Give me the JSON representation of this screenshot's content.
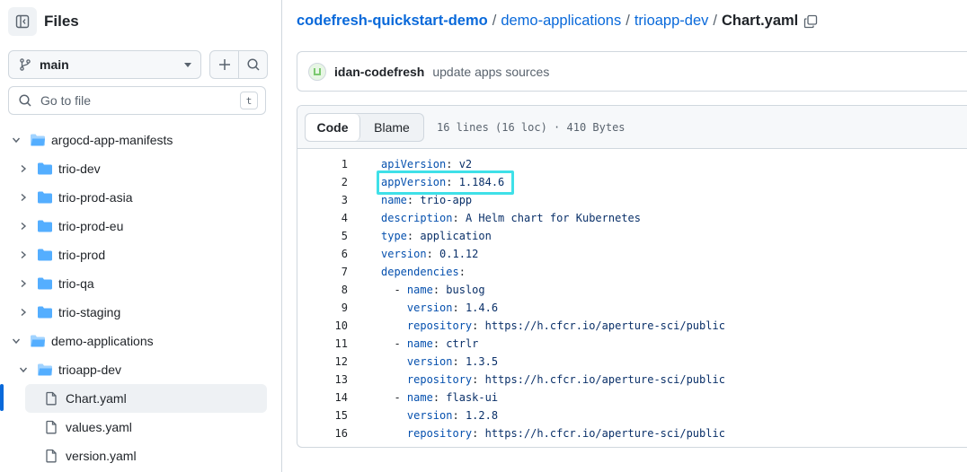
{
  "sidebar": {
    "title": "Files",
    "branch": "main",
    "goto_placeholder": "Go to file",
    "goto_shortcut": "t",
    "tree": [
      {
        "label": "argocd-app-manifests",
        "type": "folder",
        "open": true,
        "depth": 0
      },
      {
        "label": "trio-dev",
        "type": "folder",
        "open": false,
        "depth": 1
      },
      {
        "label": "trio-prod-asia",
        "type": "folder",
        "open": false,
        "depth": 1
      },
      {
        "label": "trio-prod-eu",
        "type": "folder",
        "open": false,
        "depth": 1
      },
      {
        "label": "trio-prod",
        "type": "folder",
        "open": false,
        "depth": 1
      },
      {
        "label": "trio-qa",
        "type": "folder",
        "open": false,
        "depth": 1
      },
      {
        "label": "trio-staging",
        "type": "folder",
        "open": false,
        "depth": 1
      },
      {
        "label": "demo-applications",
        "type": "folder",
        "open": true,
        "depth": 0
      },
      {
        "label": "trioapp-dev",
        "type": "folder",
        "open": true,
        "depth": 1
      },
      {
        "label": "Chart.yaml",
        "type": "file",
        "selected": true,
        "depth": 2
      },
      {
        "label": "values.yaml",
        "type": "file",
        "depth": 2
      },
      {
        "label": "version.yaml",
        "type": "file",
        "depth": 2
      }
    ]
  },
  "breadcrumb": {
    "repo": "codefresh-quickstart-demo",
    "dir1": "demo-applications",
    "dir2": "trioapp-dev",
    "file": "Chart.yaml",
    "separator": "/"
  },
  "commit": {
    "author": "idan-codefresh",
    "message": "update apps sources"
  },
  "file_view": {
    "tab_code": "Code",
    "tab_blame": "Blame",
    "meta": "16 lines (16 loc) · 410 Bytes",
    "lines": [
      {
        "n": "1",
        "indent": "",
        "key": "apiVersion",
        "value": "v2"
      },
      {
        "n": "2",
        "indent": "",
        "key": "appVersion",
        "value": "1.184.6"
      },
      {
        "n": "3",
        "indent": "",
        "key": "name",
        "value": "trio-app"
      },
      {
        "n": "4",
        "indent": "",
        "key": "description",
        "value": "A Helm chart for Kubernetes"
      },
      {
        "n": "5",
        "indent": "",
        "key": "type",
        "value": "application"
      },
      {
        "n": "6",
        "indent": "",
        "key": "version",
        "value": "0.1.12"
      },
      {
        "n": "7",
        "indent": "",
        "key": "dependencies",
        "value": ""
      },
      {
        "n": "8",
        "indent": "  - ",
        "key": "name",
        "value": "buslog"
      },
      {
        "n": "9",
        "indent": "    ",
        "key": "version",
        "value": "1.4.6"
      },
      {
        "n": "10",
        "indent": "    ",
        "key": "repository",
        "value": "https://h.cfcr.io/aperture-sci/public"
      },
      {
        "n": "11",
        "indent": "  - ",
        "key": "name",
        "value": "ctrlr"
      },
      {
        "n": "12",
        "indent": "    ",
        "key": "version",
        "value": "1.3.5"
      },
      {
        "n": "13",
        "indent": "    ",
        "key": "repository",
        "value": "https://h.cfcr.io/aperture-sci/public"
      },
      {
        "n": "14",
        "indent": "  - ",
        "key": "name",
        "value": "flask-ui"
      },
      {
        "n": "15",
        "indent": "    ",
        "key": "version",
        "value": "1.2.8"
      },
      {
        "n": "16",
        "indent": "    ",
        "key": "repository",
        "value": "https://h.cfcr.io/aperture-sci/public"
      }
    ]
  },
  "colors": {
    "link": "#0969da",
    "folder": "#54aeff",
    "highlight": "#3fe0e8",
    "yaml_key": "#0550ae",
    "yaml_value": "#0a3069"
  }
}
